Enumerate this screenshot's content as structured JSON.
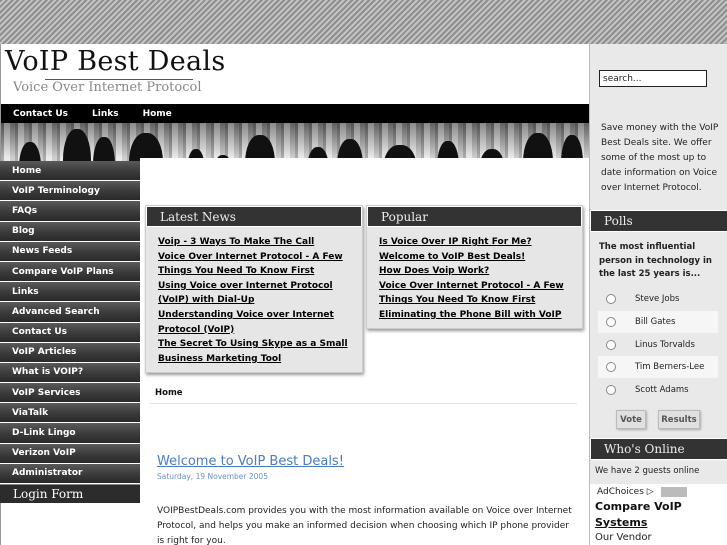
{
  "site": {
    "title": "VoIP Best Deals",
    "subtitle": "Voice Over Internet Protocol"
  },
  "topnav": [
    "Contact Us",
    "Links",
    "Home"
  ],
  "leftnav": {
    "items": [
      "Home",
      "VoIP Terminology",
      "FAQs",
      "Blog",
      "News Feeds",
      "Compare VoIP Plans",
      "Links",
      "Advanced Search",
      "Contact Us",
      "VoIP Articles",
      "What is VOIP?",
      "VoIP Services",
      "ViaTalk",
      "D-Link Lingo",
      "Verizon VoIP",
      "Administrator"
    ],
    "login_heading": "Login Form"
  },
  "latest_news": {
    "heading": "Latest News",
    "items": [
      "Voip - 3 Ways To Make The Call",
      "Voice Over Internet Protocol - A Few Things You Need To Know First",
      "Using Voice over Internet Protocol (VoIP) with Dial-Up",
      "Understanding Voice over Internet Protocol (VoIP)",
      "The Secret To Using Skype as a Small Business Marketing Tool"
    ]
  },
  "popular": {
    "heading": "Popular",
    "items": [
      "Is Voice Over IP Right For Me?",
      "Welcome to VoIP Best Deals!",
      "How Does Voip Work?",
      "Voice Over Internet Protocol - A Few Things You Need To Know First",
      "Eliminating the Phone Bill with VoIP"
    ]
  },
  "breadcrumb": "Home",
  "article": {
    "title": "Welcome to VoIP Best Deals!",
    "date": "Saturday, 19 November 2005",
    "body": "VOIPBestDeals.com provides you with the most information available on Voice over Internet Protocol, and helps you make an informed decision when choosing which IP phone provider is right for you."
  },
  "sidebar": {
    "search_value": "search...",
    "promo": "Save money with the VoIP Best Deals site. We offer some of the most up to date information on Voice over Internet Protocol.",
    "polls_heading": "Polls",
    "poll_question": "The most influential person in technology in the last 25 years is...",
    "poll_options": [
      "Steve Jobs",
      "Bill Gates",
      "Linus Torvalds",
      "Tim Berners-Lee",
      "Scott Adams"
    ],
    "vote_label": "Vote",
    "results_label": "Results",
    "online_heading": "Who's Online",
    "online_text": "We have 2 guests online"
  },
  "ad": {
    "choices_label": "AdChoices",
    "title_line1": "Compare VoIP",
    "title_line2": "Systems",
    "body": "Our Vendor"
  }
}
